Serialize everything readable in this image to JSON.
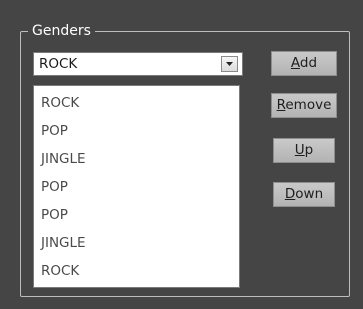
{
  "group": {
    "title": "Genders"
  },
  "combo": {
    "selected": "ROCK",
    "arrow_icon": "chevron-down-icon"
  },
  "list": {
    "items": [
      "ROCK",
      "POP",
      "JINGLE",
      "POP",
      "POP",
      "JINGLE",
      "ROCK"
    ]
  },
  "buttons": {
    "add": {
      "mnemonic": "A",
      "rest": "dd"
    },
    "remove": {
      "mnemonic": "R",
      "rest": "emove"
    },
    "up": {
      "mnemonic": "U",
      "rest": "p"
    },
    "down": {
      "mnemonic": "D",
      "rest": "own"
    }
  }
}
